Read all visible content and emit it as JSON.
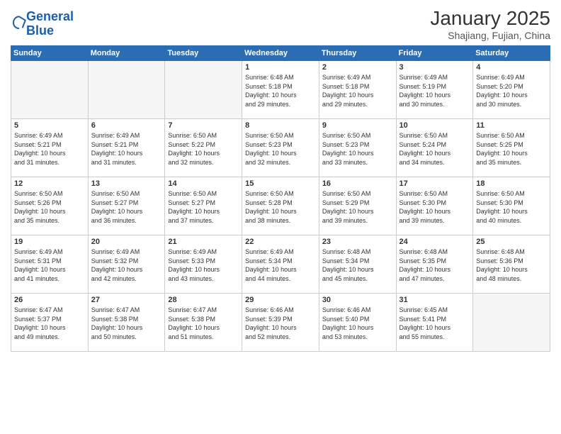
{
  "header": {
    "logo_line1": "General",
    "logo_line2": "Blue",
    "title": "January 2025",
    "subtitle": "Shajiang, Fujian, China"
  },
  "days_of_week": [
    "Sunday",
    "Monday",
    "Tuesday",
    "Wednesday",
    "Thursday",
    "Friday",
    "Saturday"
  ],
  "weeks": [
    [
      {
        "day": "",
        "info": ""
      },
      {
        "day": "",
        "info": ""
      },
      {
        "day": "",
        "info": ""
      },
      {
        "day": "1",
        "info": "Sunrise: 6:48 AM\nSunset: 5:18 PM\nDaylight: 10 hours\nand 29 minutes."
      },
      {
        "day": "2",
        "info": "Sunrise: 6:49 AM\nSunset: 5:18 PM\nDaylight: 10 hours\nand 29 minutes."
      },
      {
        "day": "3",
        "info": "Sunrise: 6:49 AM\nSunset: 5:19 PM\nDaylight: 10 hours\nand 30 minutes."
      },
      {
        "day": "4",
        "info": "Sunrise: 6:49 AM\nSunset: 5:20 PM\nDaylight: 10 hours\nand 30 minutes."
      }
    ],
    [
      {
        "day": "5",
        "info": "Sunrise: 6:49 AM\nSunset: 5:21 PM\nDaylight: 10 hours\nand 31 minutes."
      },
      {
        "day": "6",
        "info": "Sunrise: 6:49 AM\nSunset: 5:21 PM\nDaylight: 10 hours\nand 31 minutes."
      },
      {
        "day": "7",
        "info": "Sunrise: 6:50 AM\nSunset: 5:22 PM\nDaylight: 10 hours\nand 32 minutes."
      },
      {
        "day": "8",
        "info": "Sunrise: 6:50 AM\nSunset: 5:23 PM\nDaylight: 10 hours\nand 32 minutes."
      },
      {
        "day": "9",
        "info": "Sunrise: 6:50 AM\nSunset: 5:23 PM\nDaylight: 10 hours\nand 33 minutes."
      },
      {
        "day": "10",
        "info": "Sunrise: 6:50 AM\nSunset: 5:24 PM\nDaylight: 10 hours\nand 34 minutes."
      },
      {
        "day": "11",
        "info": "Sunrise: 6:50 AM\nSunset: 5:25 PM\nDaylight: 10 hours\nand 35 minutes."
      }
    ],
    [
      {
        "day": "12",
        "info": "Sunrise: 6:50 AM\nSunset: 5:26 PM\nDaylight: 10 hours\nand 35 minutes."
      },
      {
        "day": "13",
        "info": "Sunrise: 6:50 AM\nSunset: 5:27 PM\nDaylight: 10 hours\nand 36 minutes."
      },
      {
        "day": "14",
        "info": "Sunrise: 6:50 AM\nSunset: 5:27 PM\nDaylight: 10 hours\nand 37 minutes."
      },
      {
        "day": "15",
        "info": "Sunrise: 6:50 AM\nSunset: 5:28 PM\nDaylight: 10 hours\nand 38 minutes."
      },
      {
        "day": "16",
        "info": "Sunrise: 6:50 AM\nSunset: 5:29 PM\nDaylight: 10 hours\nand 39 minutes."
      },
      {
        "day": "17",
        "info": "Sunrise: 6:50 AM\nSunset: 5:30 PM\nDaylight: 10 hours\nand 39 minutes."
      },
      {
        "day": "18",
        "info": "Sunrise: 6:50 AM\nSunset: 5:30 PM\nDaylight: 10 hours\nand 40 minutes."
      }
    ],
    [
      {
        "day": "19",
        "info": "Sunrise: 6:49 AM\nSunset: 5:31 PM\nDaylight: 10 hours\nand 41 minutes."
      },
      {
        "day": "20",
        "info": "Sunrise: 6:49 AM\nSunset: 5:32 PM\nDaylight: 10 hours\nand 42 minutes."
      },
      {
        "day": "21",
        "info": "Sunrise: 6:49 AM\nSunset: 5:33 PM\nDaylight: 10 hours\nand 43 minutes."
      },
      {
        "day": "22",
        "info": "Sunrise: 6:49 AM\nSunset: 5:34 PM\nDaylight: 10 hours\nand 44 minutes."
      },
      {
        "day": "23",
        "info": "Sunrise: 6:48 AM\nSunset: 5:34 PM\nDaylight: 10 hours\nand 45 minutes."
      },
      {
        "day": "24",
        "info": "Sunrise: 6:48 AM\nSunset: 5:35 PM\nDaylight: 10 hours\nand 47 minutes."
      },
      {
        "day": "25",
        "info": "Sunrise: 6:48 AM\nSunset: 5:36 PM\nDaylight: 10 hours\nand 48 minutes."
      }
    ],
    [
      {
        "day": "26",
        "info": "Sunrise: 6:47 AM\nSunset: 5:37 PM\nDaylight: 10 hours\nand 49 minutes."
      },
      {
        "day": "27",
        "info": "Sunrise: 6:47 AM\nSunset: 5:38 PM\nDaylight: 10 hours\nand 50 minutes."
      },
      {
        "day": "28",
        "info": "Sunrise: 6:47 AM\nSunset: 5:38 PM\nDaylight: 10 hours\nand 51 minutes."
      },
      {
        "day": "29",
        "info": "Sunrise: 6:46 AM\nSunset: 5:39 PM\nDaylight: 10 hours\nand 52 minutes."
      },
      {
        "day": "30",
        "info": "Sunrise: 6:46 AM\nSunset: 5:40 PM\nDaylight: 10 hours\nand 53 minutes."
      },
      {
        "day": "31",
        "info": "Sunrise: 6:45 AM\nSunset: 5:41 PM\nDaylight: 10 hours\nand 55 minutes."
      },
      {
        "day": "",
        "info": ""
      }
    ]
  ]
}
